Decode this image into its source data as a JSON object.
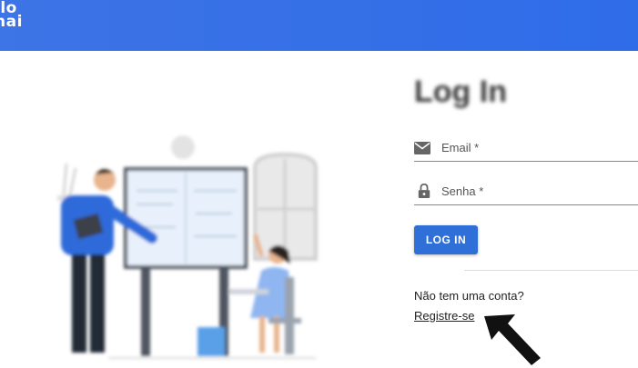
{
  "header": {
    "logo_line1": "llo",
    "logo_line2": "nai",
    "brand_color": "#2f6ce8"
  },
  "login": {
    "title": "Log In",
    "email_label": "Email *",
    "password_label": "Senha *",
    "login_button": "LOG IN",
    "no_account_text": "Não tem uma conta?",
    "register_link": "Registre-se"
  },
  "icons": {
    "email": "mail-icon",
    "password": "lock-icon",
    "annotation": "arrow-pointer-icon"
  }
}
